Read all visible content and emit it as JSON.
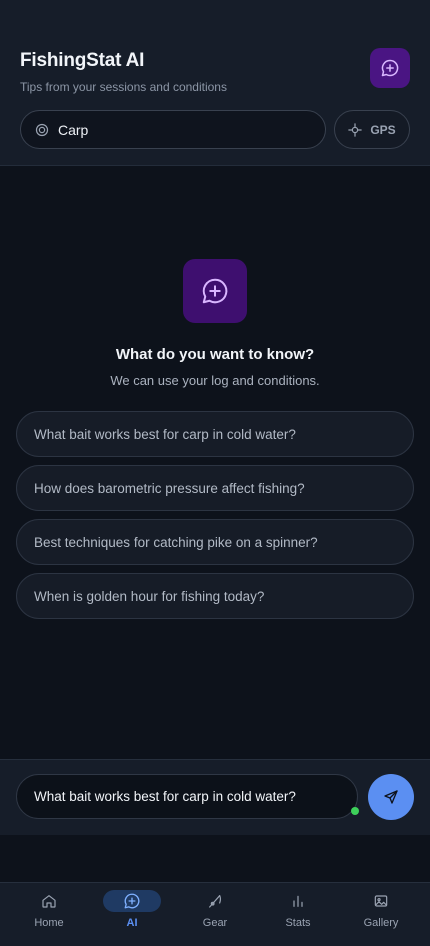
{
  "header": {
    "title": "FishingStat AI",
    "subtitle": "Tips from your sessions and conditions",
    "chat_icon": "chat-sparkle-icon"
  },
  "species": {
    "value": "Carp",
    "icon": "target-icon"
  },
  "gps_button": {
    "label": "GPS",
    "icon": "crosshair-icon"
  },
  "empty_state": {
    "icon": "chat-sparkle-icon",
    "title": "What do you want to know?",
    "subtitle": "We can use your log and conditions."
  },
  "suggestions": [
    "What bait works best for carp in cold water?",
    "How does barometric pressure affect fishing?",
    "Best techniques for catching pike on a spinner?",
    "When is golden hour for fishing today?"
  ],
  "composer": {
    "value": "What bait works best for carp in cold water?",
    "send_icon": "send-icon"
  },
  "nav": {
    "items": [
      {
        "label": "Home",
        "icon": "home-icon"
      },
      {
        "label": "AI",
        "icon": "chat-sparkle-icon",
        "active": true
      },
      {
        "label": "Gear",
        "icon": "fishing-rod-icon"
      },
      {
        "label": "Stats",
        "icon": "bar-chart-icon"
      },
      {
        "label": "Gallery",
        "icon": "image-icon"
      }
    ]
  },
  "colors": {
    "accent": "#5b8ff2",
    "ai_purple": "#4a1583",
    "background": "#0d121b",
    "status_online": "#3dd05a"
  }
}
